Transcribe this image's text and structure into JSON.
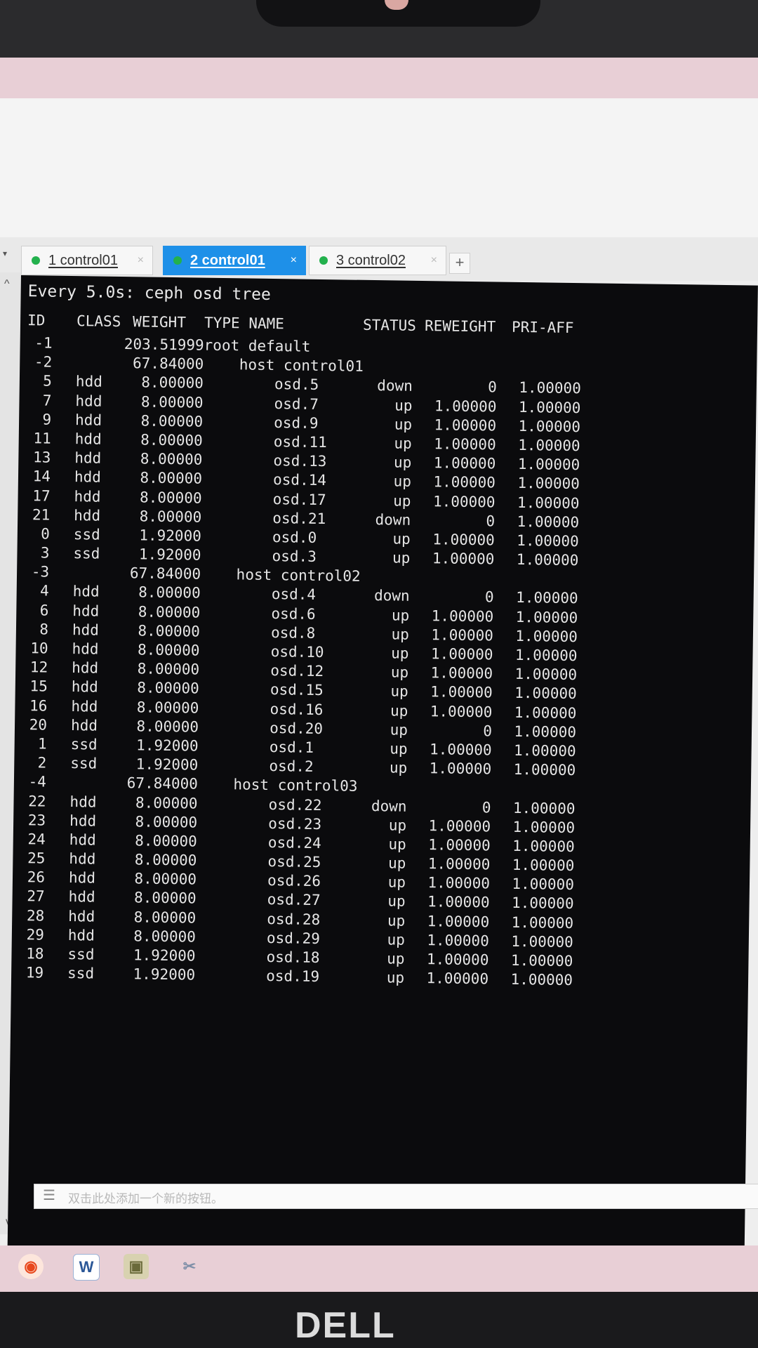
{
  "tabs": [
    {
      "label": "1 control01",
      "active": false,
      "close": "×"
    },
    {
      "label": "2 control01",
      "active": true,
      "close": "×"
    },
    {
      "label": "3 control02",
      "active": false,
      "close": "×"
    }
  ],
  "tab_add": "+",
  "terminal": {
    "command_line": "Every 5.0s: ceph osd tree",
    "headers": {
      "id": "ID",
      "class": "CLASS",
      "weight": "WEIGHT",
      "type_name": "TYPE NAME",
      "status": "STATUS",
      "reweight": "REWEIGHT",
      "pri_aff": "PRI-AFF"
    },
    "rows": [
      {
        "id": "-1",
        "class": "",
        "weight": "203.51999",
        "name": "root default",
        "status": "",
        "reweight": "",
        "pri_aff": ""
      },
      {
        "id": "-2",
        "class": "",
        "weight": "67.84000",
        "name": "    host control01",
        "status": "",
        "reweight": "",
        "pri_aff": ""
      },
      {
        "id": "5",
        "class": "hdd",
        "weight": "8.00000",
        "name": "        osd.5",
        "status": "down",
        "reweight": "0",
        "pri_aff": "1.00000"
      },
      {
        "id": "7",
        "class": "hdd",
        "weight": "8.00000",
        "name": "        osd.7",
        "status": "up",
        "reweight": "1.00000",
        "pri_aff": "1.00000"
      },
      {
        "id": "9",
        "class": "hdd",
        "weight": "8.00000",
        "name": "        osd.9",
        "status": "up",
        "reweight": "1.00000",
        "pri_aff": "1.00000"
      },
      {
        "id": "11",
        "class": "hdd",
        "weight": "8.00000",
        "name": "        osd.11",
        "status": "up",
        "reweight": "1.00000",
        "pri_aff": "1.00000"
      },
      {
        "id": "13",
        "class": "hdd",
        "weight": "8.00000",
        "name": "        osd.13",
        "status": "up",
        "reweight": "1.00000",
        "pri_aff": "1.00000"
      },
      {
        "id": "14",
        "class": "hdd",
        "weight": "8.00000",
        "name": "        osd.14",
        "status": "up",
        "reweight": "1.00000",
        "pri_aff": "1.00000"
      },
      {
        "id": "17",
        "class": "hdd",
        "weight": "8.00000",
        "name": "        osd.17",
        "status": "up",
        "reweight": "1.00000",
        "pri_aff": "1.00000"
      },
      {
        "id": "21",
        "class": "hdd",
        "weight": "8.00000",
        "name": "        osd.21",
        "status": "down",
        "reweight": "0",
        "pri_aff": "1.00000"
      },
      {
        "id": "0",
        "class": "ssd",
        "weight": "1.92000",
        "name": "        osd.0",
        "status": "up",
        "reweight": "1.00000",
        "pri_aff": "1.00000"
      },
      {
        "id": "3",
        "class": "ssd",
        "weight": "1.92000",
        "name": "        osd.3",
        "status": "up",
        "reweight": "1.00000",
        "pri_aff": "1.00000"
      },
      {
        "id": "-3",
        "class": "",
        "weight": "67.84000",
        "name": "    host control02",
        "status": "",
        "reweight": "",
        "pri_aff": ""
      },
      {
        "id": "4",
        "class": "hdd",
        "weight": "8.00000",
        "name": "        osd.4",
        "status": "down",
        "reweight": "0",
        "pri_aff": "1.00000"
      },
      {
        "id": "6",
        "class": "hdd",
        "weight": "8.00000",
        "name": "        osd.6",
        "status": "up",
        "reweight": "1.00000",
        "pri_aff": "1.00000"
      },
      {
        "id": "8",
        "class": "hdd",
        "weight": "8.00000",
        "name": "        osd.8",
        "status": "up",
        "reweight": "1.00000",
        "pri_aff": "1.00000"
      },
      {
        "id": "10",
        "class": "hdd",
        "weight": "8.00000",
        "name": "        osd.10",
        "status": "up",
        "reweight": "1.00000",
        "pri_aff": "1.00000"
      },
      {
        "id": "12",
        "class": "hdd",
        "weight": "8.00000",
        "name": "        osd.12",
        "status": "up",
        "reweight": "1.00000",
        "pri_aff": "1.00000"
      },
      {
        "id": "15",
        "class": "hdd",
        "weight": "8.00000",
        "name": "        osd.15",
        "status": "up",
        "reweight": "1.00000",
        "pri_aff": "1.00000"
      },
      {
        "id": "16",
        "class": "hdd",
        "weight": "8.00000",
        "name": "        osd.16",
        "status": "up",
        "reweight": "1.00000",
        "pri_aff": "1.00000"
      },
      {
        "id": "20",
        "class": "hdd",
        "weight": "8.00000",
        "name": "        osd.20",
        "status": "up",
        "reweight": "0",
        "pri_aff": "1.00000"
      },
      {
        "id": "1",
        "class": "ssd",
        "weight": "1.92000",
        "name": "        osd.1",
        "status": "up",
        "reweight": "1.00000",
        "pri_aff": "1.00000"
      },
      {
        "id": "2",
        "class": "ssd",
        "weight": "1.92000",
        "name": "        osd.2",
        "status": "up",
        "reweight": "1.00000",
        "pri_aff": "1.00000"
      },
      {
        "id": "-4",
        "class": "",
        "weight": "67.84000",
        "name": "    host control03",
        "status": "",
        "reweight": "",
        "pri_aff": ""
      },
      {
        "id": "22",
        "class": "hdd",
        "weight": "8.00000",
        "name": "        osd.22",
        "status": "down",
        "reweight": "0",
        "pri_aff": "1.00000"
      },
      {
        "id": "23",
        "class": "hdd",
        "weight": "8.00000",
        "name": "        osd.23",
        "status": "up",
        "reweight": "1.00000",
        "pri_aff": "1.00000"
      },
      {
        "id": "24",
        "class": "hdd",
        "weight": "8.00000",
        "name": "        osd.24",
        "status": "up",
        "reweight": "1.00000",
        "pri_aff": "1.00000"
      },
      {
        "id": "25",
        "class": "hdd",
        "weight": "8.00000",
        "name": "        osd.25",
        "status": "up",
        "reweight": "1.00000",
        "pri_aff": "1.00000"
      },
      {
        "id": "26",
        "class": "hdd",
        "weight": "8.00000",
        "name": "        osd.26",
        "status": "up",
        "reweight": "1.00000",
        "pri_aff": "1.00000"
      },
      {
        "id": "27",
        "class": "hdd",
        "weight": "8.00000",
        "name": "        osd.27",
        "status": "up",
        "reweight": "1.00000",
        "pri_aff": "1.00000"
      },
      {
        "id": "28",
        "class": "hdd",
        "weight": "8.00000",
        "name": "        osd.28",
        "status": "up",
        "reweight": "1.00000",
        "pri_aff": "1.00000"
      },
      {
        "id": "29",
        "class": "hdd",
        "weight": "8.00000",
        "name": "        osd.29",
        "status": "up",
        "reweight": "1.00000",
        "pri_aff": "1.00000"
      },
      {
        "id": "18",
        "class": "ssd",
        "weight": "1.92000",
        "name": "        osd.18",
        "status": "up",
        "reweight": "1.00000",
        "pri_aff": "1.00000"
      },
      {
        "id": "19",
        "class": "ssd",
        "weight": "1.92000",
        "name": "        osd.19",
        "status": "up",
        "reweight": "1.00000",
        "pri_aff": "1.00000"
      }
    ]
  },
  "command_bar": {
    "placeholder": "双击此处添加一个新的按钮。",
    "icon": "menu-icon"
  },
  "taskbar": {
    "icons": [
      "app-swirl-icon",
      "word-icon",
      "camera-icon",
      "tool-icon"
    ],
    "word_letter": "W"
  },
  "brand": "DELL",
  "colors": {
    "active_tab": "#1e90e8",
    "tab_dot": "#23b14d",
    "terminal_bg": "#0b0b0d",
    "terminal_text": "#e6e6e6",
    "taskbar": "#e8cfd6"
  }
}
